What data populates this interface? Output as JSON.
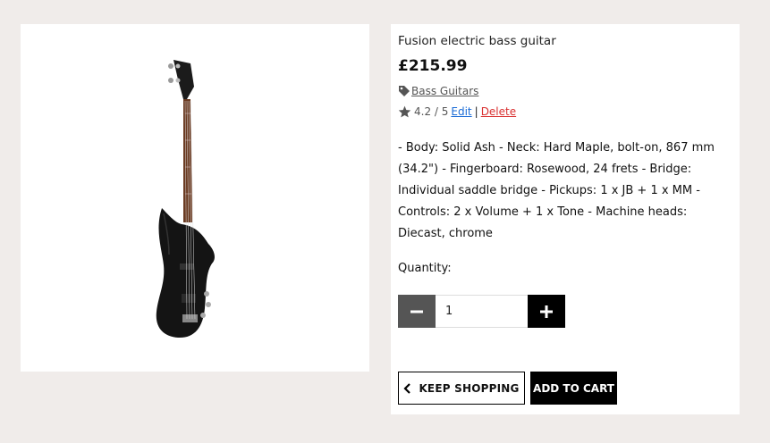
{
  "product": {
    "image_alt": "Fusion electric bass guitar",
    "title": "Fusion electric bass guitar",
    "price": "£215.99",
    "category": {
      "icon": "tag-icon",
      "label": "Bass Guitars"
    },
    "rating": {
      "icon": "star-icon",
      "value": "4.2 / 5",
      "edit_label": "Edit",
      "separator": "|",
      "delete_label": "Delete"
    },
    "description": "- Body: Solid Ash - Neck: Hard Maple, bolt-on, 867 mm (34.2\") - Fingerboard: Rosewood, 24 frets - Bridge: Individual saddle bridge - Pickups: 1 x JB + 1 x MM - Controls: 2 x Volume + 1 x Tone - Machine heads: Diecast, chrome"
  },
  "quantity": {
    "label": "Quantity:",
    "value": "1",
    "minus_icon": "minus-icon",
    "plus_icon": "plus-icon"
  },
  "actions": {
    "keep_shopping_label": "KEEP SHOPPING",
    "keep_shopping_icon": "chevron-left-icon",
    "add_to_cart_label": "ADD TO CART"
  },
  "colors": {
    "page_bg": "#f0ecea",
    "card_bg": "#ffffff",
    "edit_link": "#1a6bd6",
    "delete_link": "#d93030",
    "primary_button": "#000000",
    "minus_button": "#555555"
  }
}
